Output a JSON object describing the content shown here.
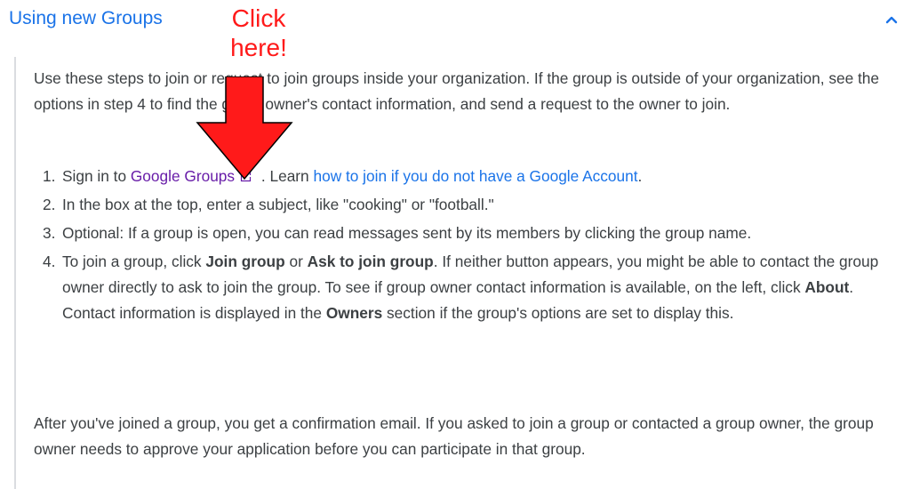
{
  "header": {
    "title": "Using new Groups",
    "chevron_icon": "chevron-up-icon"
  },
  "annotation": {
    "text_line1": "Click",
    "text_line2": "here!",
    "color": "#ff1a1a",
    "arrow_icon": "red-down-arrow"
  },
  "intro": {
    "text_part1": "Use these steps to join or request to join groups inside your organization. If the group is outside of your organization, see the options in step 4 to find the group owner's contact information, and send a request to the owner to join."
  },
  "steps": {
    "s1": {
      "num": "1.",
      "pre": "Sign in to ",
      "link_groups": "Google Groups",
      "mid": " . Learn ",
      "link_account": "how to join if you do not have a Google Account",
      "post": "."
    },
    "s2": {
      "num": "2.",
      "text": "In the box at the top, enter a subject, like \"cooking\" or \"football.\""
    },
    "s3": {
      "num": "3.",
      "text": "Optional: If a group is open, you can read messages sent by its members by clicking the group name."
    },
    "s4": {
      "num": "4.",
      "t1": "To join a group, click ",
      "b1": "Join group",
      "t2": " or ",
      "b2": "Ask to join group",
      "t3": ". If neither button appears, you might be able to contact the group owner directly to ask to join the group. To see if group owner contact information is available, on the left, click ",
      "b3": "About",
      "t4": ". Contact information is displayed in the ",
      "b4": "Owners",
      "t5": " section if the group's options are set to display this."
    }
  },
  "outro": {
    "text": "After you've joined a group, you get a confirmation email. If you asked to join a group or contacted a group owner, the group owner needs to approve your application before you can participate in that group."
  },
  "colors": {
    "header_link": "#1a73e8",
    "body_text": "#3c4043",
    "visited_link": "#681da8",
    "rule": "#dadce0"
  }
}
